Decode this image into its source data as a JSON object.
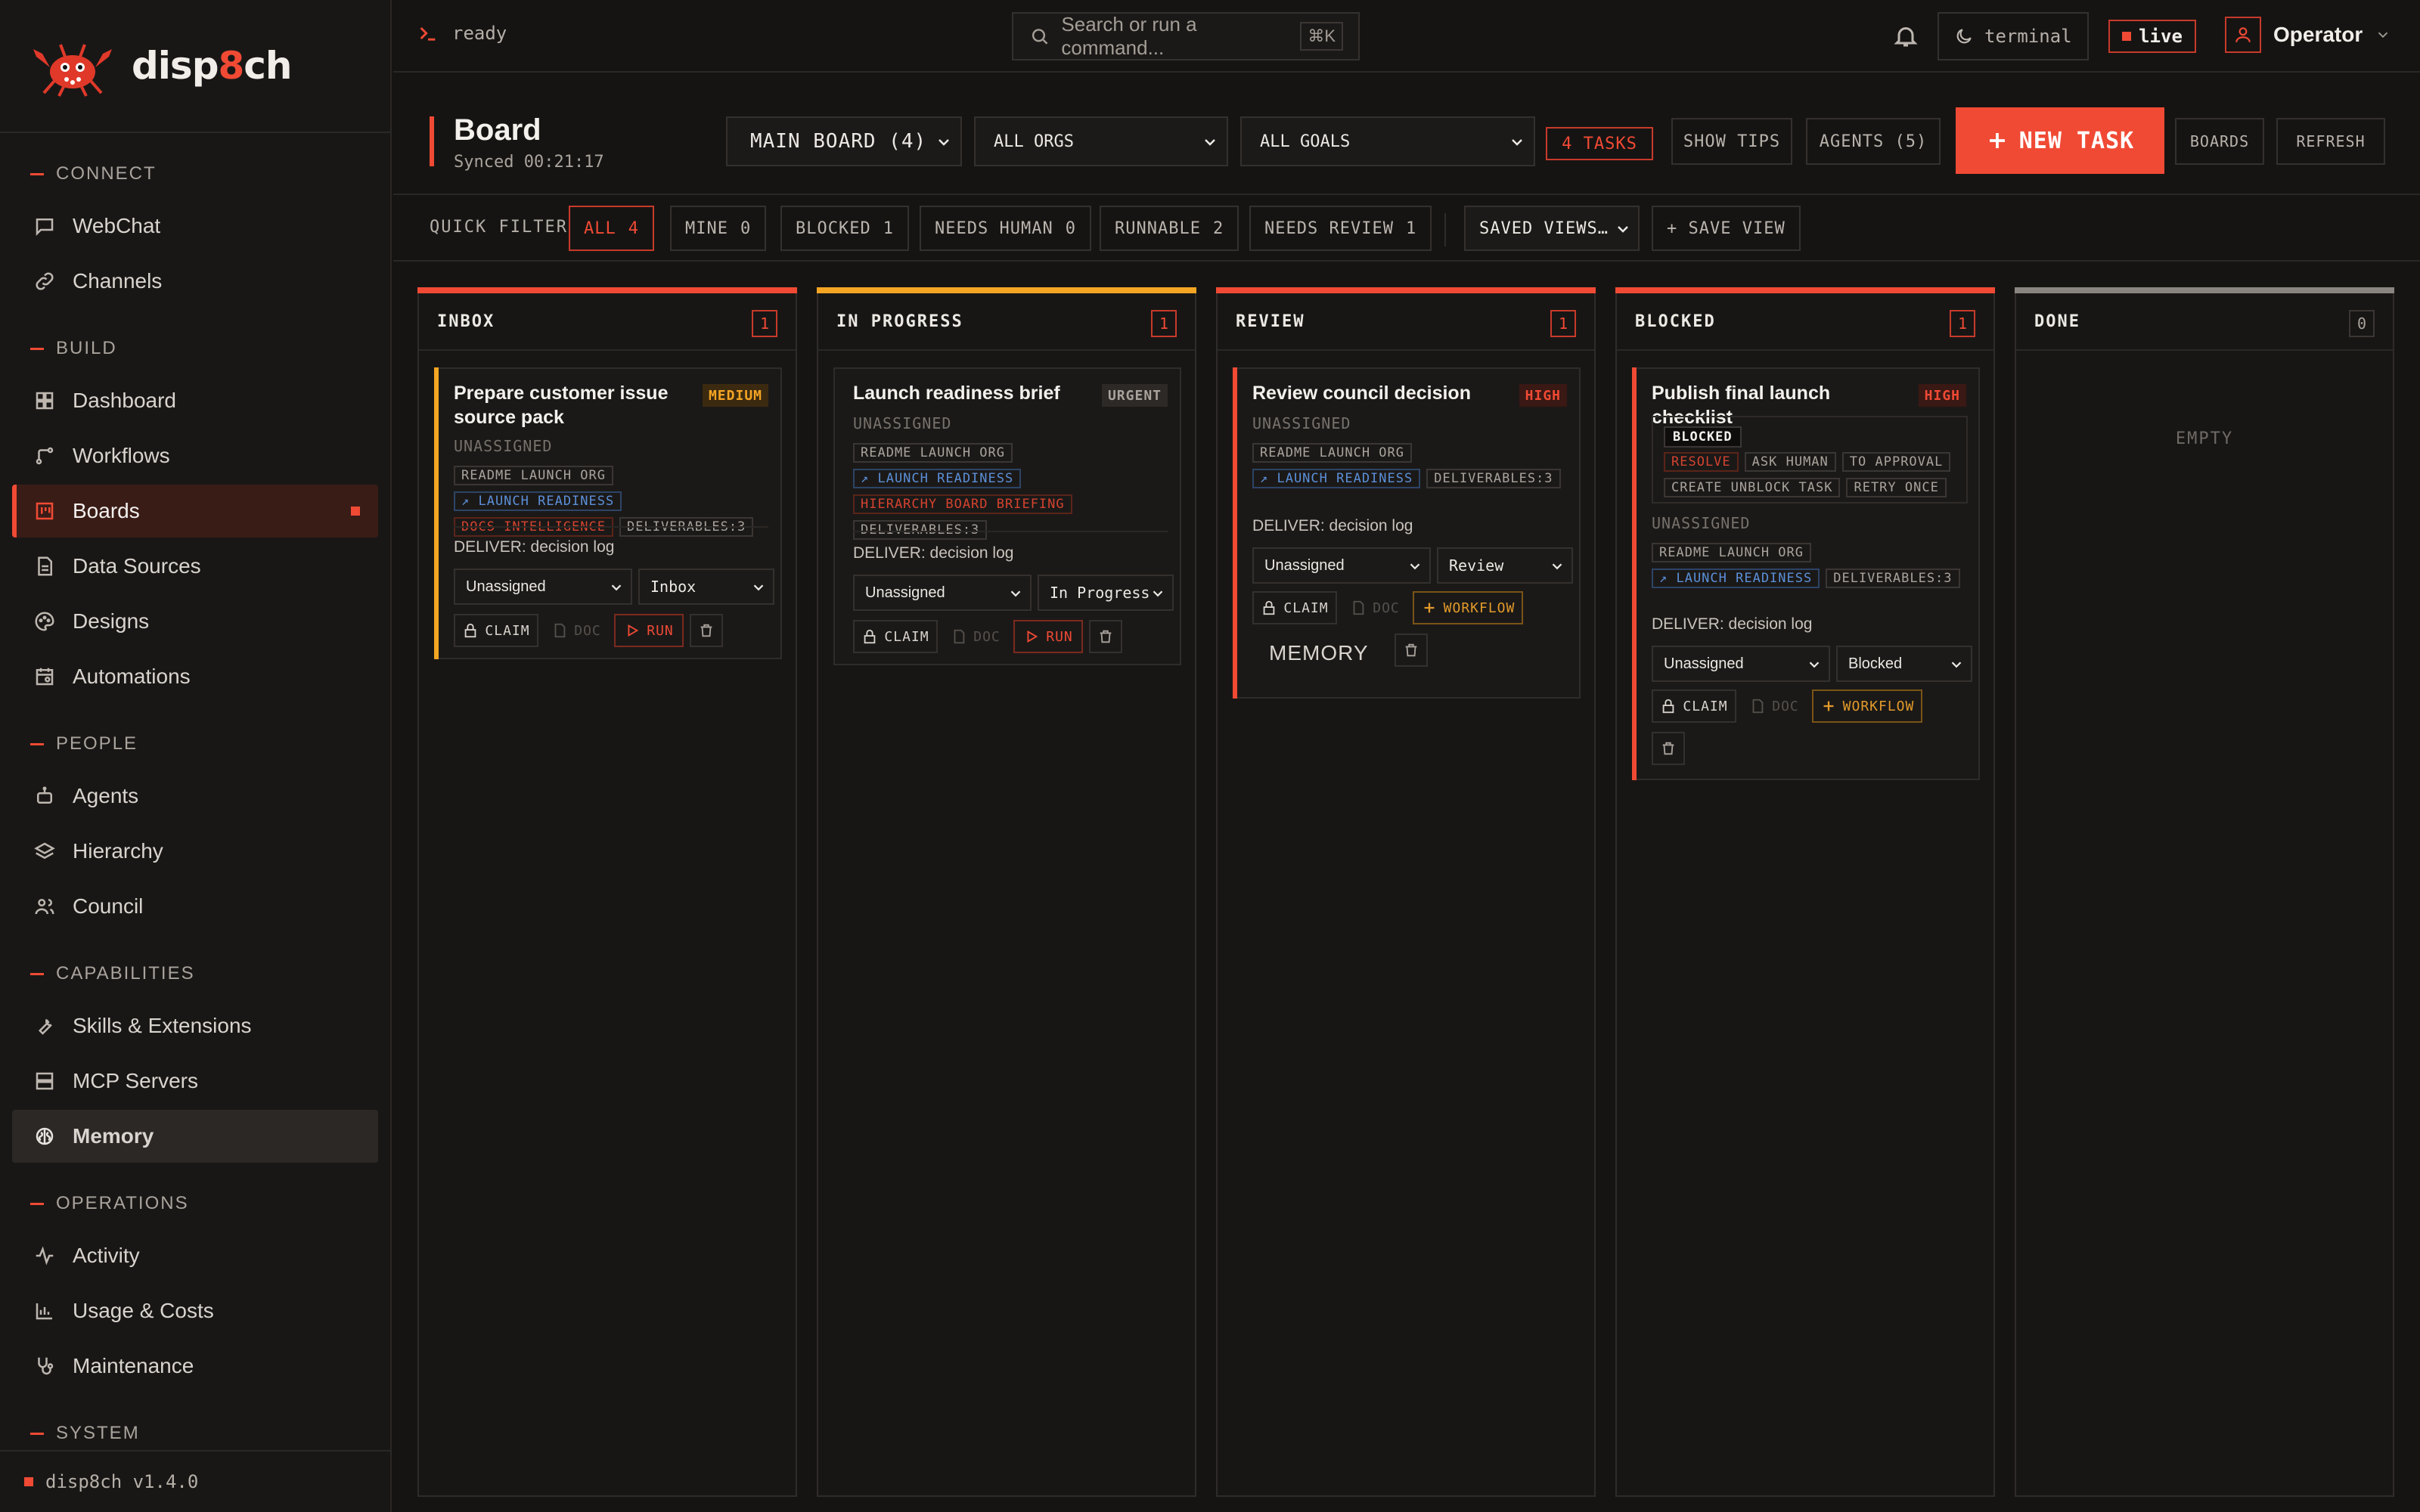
{
  "brand": {
    "name_pre": "disp",
    "name_accent": "8",
    "name_post": "ch"
  },
  "sidebar": {
    "sections": [
      {
        "title": "CONNECT",
        "items": [
          {
            "label": "WebChat",
            "icon": "chat-icon"
          },
          {
            "label": "Channels",
            "icon": "link-icon"
          }
        ]
      },
      {
        "title": "BUILD",
        "items": [
          {
            "label": "Dashboard",
            "icon": "grid-icon"
          },
          {
            "label": "Workflows",
            "icon": "workflow-icon"
          },
          {
            "label": "Boards",
            "icon": "board-icon",
            "active": true
          },
          {
            "label": "Data Sources",
            "icon": "document-icon"
          },
          {
            "label": "Designs",
            "icon": "palette-icon"
          },
          {
            "label": "Automations",
            "icon": "calendar-icon"
          }
        ]
      },
      {
        "title": "PEOPLE",
        "items": [
          {
            "label": "Agents",
            "icon": "bot-icon"
          },
          {
            "label": "Hierarchy",
            "icon": "layers-icon"
          },
          {
            "label": "Council",
            "icon": "users-icon"
          }
        ]
      },
      {
        "title": "CAPABILITIES",
        "items": [
          {
            "label": "Skills & Extensions",
            "icon": "wrench-icon"
          },
          {
            "label": "MCP Servers",
            "icon": "server-icon"
          },
          {
            "label": "Memory",
            "icon": "brain-icon",
            "highlighted": true
          }
        ]
      },
      {
        "title": "OPERATIONS",
        "items": [
          {
            "label": "Activity",
            "icon": "activity-icon"
          },
          {
            "label": "Usage & Costs",
            "icon": "bar-chart-icon"
          },
          {
            "label": "Maintenance",
            "icon": "stethoscope-icon"
          }
        ]
      },
      {
        "title": "SYSTEM",
        "items": []
      }
    ],
    "version": "disp8ch v1.4.0"
  },
  "topbar": {
    "status": "ready",
    "search_placeholder": "Search or run a command...",
    "search_shortcut": "⌘K",
    "theme": "terminal",
    "live": "live",
    "user": "Operator"
  },
  "board": {
    "title": "Board",
    "synced": "Synced 00:21:17",
    "board_select": "MAIN BOARD (4)",
    "org_select": "ALL ORGS",
    "goal_select": "ALL GOALS",
    "task_count": "4 TASKS",
    "show_tips": "SHOW TIPS",
    "agents": "AGENTS (5)",
    "new_task": "NEW TASK",
    "boards": "BOARDS",
    "refresh": "REFRESH"
  },
  "quick_filter": {
    "label": "QUICK FILTER",
    "chips": [
      {
        "label": "ALL",
        "count": "4",
        "active": true
      },
      {
        "label": "MINE",
        "count": "0"
      },
      {
        "label": "BLOCKED",
        "count": "1"
      },
      {
        "label": "NEEDS HUMAN",
        "count": "0"
      },
      {
        "label": "RUNNABLE",
        "count": "2"
      },
      {
        "label": "NEEDS REVIEW",
        "count": "1"
      }
    ],
    "saved_views": "SAVED VIEWS…",
    "save_view": "+ SAVE VIEW"
  },
  "columns": [
    {
      "title": "INBOX",
      "count": "1",
      "color": "#f04a34"
    },
    {
      "title": "IN PROGRESS",
      "count": "1",
      "color": "#f5a524"
    },
    {
      "title": "REVIEW",
      "count": "1",
      "color": "#f04a34"
    },
    {
      "title": "BLOCKED",
      "count": "1",
      "color": "#f04a34"
    },
    {
      "title": "DONE",
      "count": "0",
      "color": "#8a8580",
      "empty": "EMPTY"
    }
  ],
  "cards": [
    {
      "column": "INBOX",
      "title": "Prepare customer issue source pack",
      "priority": "MEDIUM",
      "assignee": "UNASSIGNED",
      "tags": [
        "README LAUNCH ORG",
        "↗ LAUNCH READINESS",
        "DOCS-INTELLIGENCE",
        "DELIVERABLES:3"
      ],
      "deliver": "DELIVER: decision log",
      "assign_select": "Unassigned",
      "status_select": "Inbox",
      "actions": [
        "CLAIM",
        "DOC",
        "RUN"
      ],
      "accent": "#f5a524"
    },
    {
      "column": "IN PROGRESS",
      "title": "Launch readiness brief",
      "priority": "URGENT",
      "assignee": "UNASSIGNED",
      "tags": [
        "README LAUNCH ORG",
        "↗ LAUNCH READINESS",
        "HIERARCHY BOARD BRIEFING",
        "DELIVERABLES:3"
      ],
      "deliver": "DELIVER: decision log",
      "assign_select": "Unassigned",
      "status_select": "In Progress",
      "actions": [
        "CLAIM",
        "DOC",
        "RUN"
      ]
    },
    {
      "column": "REVIEW",
      "title": "Review council decision",
      "priority": "HIGH",
      "assignee": "UNASSIGNED",
      "tags": [
        "README LAUNCH ORG",
        "↗ LAUNCH READINESS",
        "DELIVERABLES:3"
      ],
      "deliver": "DELIVER: decision log",
      "assign_select": "Unassigned",
      "status_select": "Review",
      "actions": [
        "CLAIM",
        "DOC",
        "WORKFLOW"
      ],
      "memory": "MEMORY",
      "accent": "#f04a34"
    },
    {
      "column": "BLOCKED",
      "title": "Publish final launch checklist",
      "priority": "HIGH",
      "blocked_label": "BLOCKED",
      "blocked_actions": [
        "RESOLVE",
        "ASK HUMAN",
        "TO APPROVAL",
        "CREATE UNBLOCK TASK",
        "RETRY ONCE"
      ],
      "assignee": "UNASSIGNED",
      "tags": [
        "README LAUNCH ORG",
        "↗ LAUNCH READINESS",
        "DELIVERABLES:3"
      ],
      "deliver": "DELIVER: decision log",
      "assign_select": "Unassigned",
      "status_select": "Blocked",
      "actions": [
        "CLAIM",
        "DOC",
        "WORKFLOW"
      ],
      "accent": "#f04a34"
    }
  ]
}
